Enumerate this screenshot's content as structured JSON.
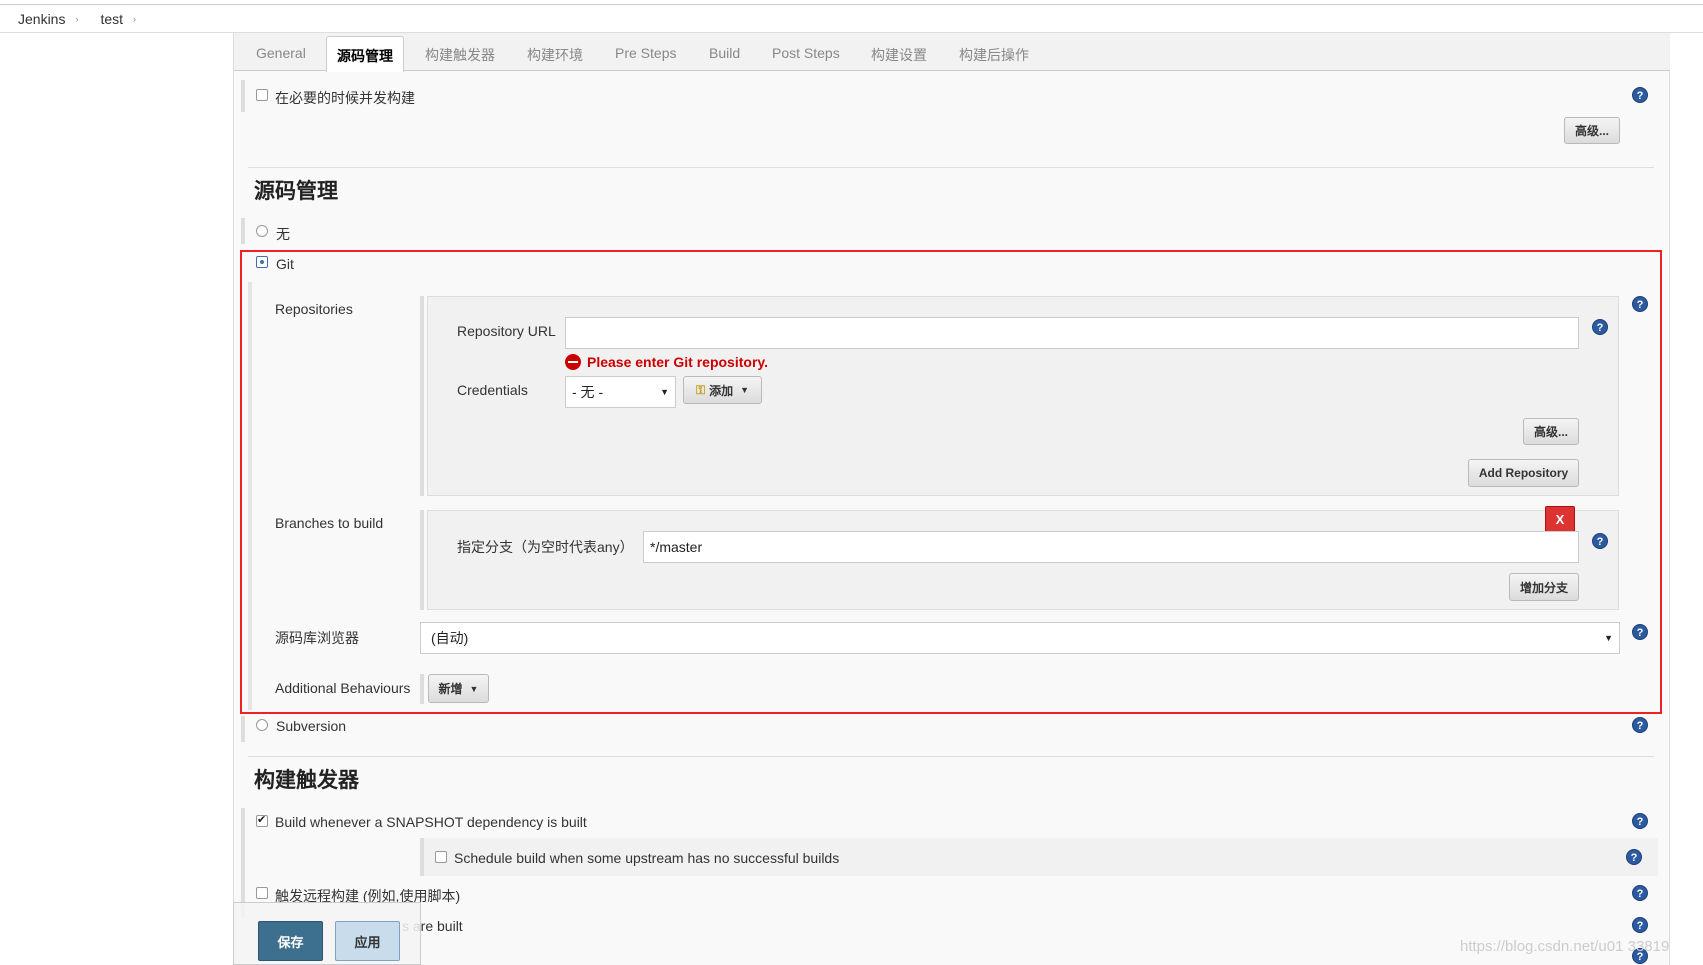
{
  "breadcrumb": {
    "items": [
      "Jenkins",
      "test"
    ],
    "separator": "›"
  },
  "tabs": [
    "General",
    "源码管理",
    "构建触发器",
    "构建环境",
    "Pre Steps",
    "Build",
    "Post Steps",
    "构建设置",
    "构建后操作"
  ],
  "general": {
    "concurrent_build_label": "在必要的时候并发构建",
    "advanced_button": "高级..."
  },
  "scm": {
    "title": "源码管理",
    "none_label": "无",
    "git_label": "Git",
    "repositories_label": "Repositories",
    "repository_url_label": "Repository URL",
    "repository_url_value": "",
    "error_message": "Please enter Git repository.",
    "credentials_label": "Credentials",
    "credentials_value": "- 无 -",
    "add_button": "添加",
    "advanced_button": "高级...",
    "add_repository_button": "Add Repository",
    "branches_label": "Branches to build",
    "branch_specifier_label": "指定分支（为空时代表any）",
    "branch_value": "*/master",
    "delete_button": "X",
    "add_branch_button": "增加分支",
    "repo_browser_label": "源码库浏览器",
    "repo_browser_value": "(自动)",
    "additional_behaviours_label": "Additional Behaviours",
    "new_button": "新增",
    "subversion_label": "Subversion"
  },
  "triggers": {
    "title": "构建触发器",
    "snapshot_label": "Build whenever a SNAPSHOT dependency is built",
    "schedule_label": "Schedule build when some upstream has no successful builds",
    "remote_label": "触发远程构建 (例如,使用脚本)",
    "partial_label": "s are built"
  },
  "help_glyph": "?",
  "footer": {
    "save_button": "保存",
    "apply_button": "应用"
  },
  "watermark": "https://blog.csdn.net/u01  33819",
  "colors": {
    "error": "#cc0000",
    "highlight_box": "#ee2222",
    "save_button": "#3d6f8e"
  }
}
